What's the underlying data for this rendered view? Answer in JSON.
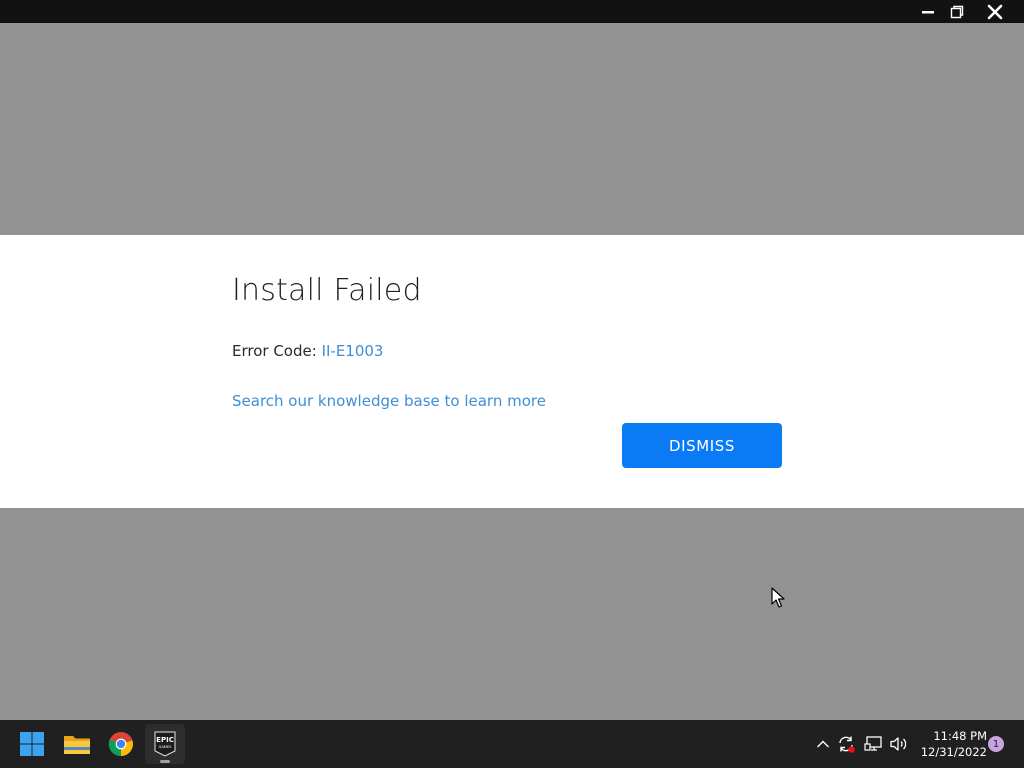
{
  "window": {
    "controls": {
      "minimize_icon": "minimize-icon",
      "restore_icon": "restore-icon",
      "close_icon": "close-icon"
    }
  },
  "dialog": {
    "title": "Install Failed",
    "error_label": "Error Code: ",
    "error_code": "II-E1003",
    "kb_link": "Search our knowledge base to learn more",
    "dismiss_label": "DISMISS"
  },
  "taskbar": {
    "apps": [
      {
        "name": "Start",
        "icon": "windows-start-icon"
      },
      {
        "name": "File Explorer",
        "icon": "folder-icon"
      },
      {
        "name": "Google Chrome",
        "icon": "chrome-icon"
      },
      {
        "name": "Epic Games Launcher",
        "icon": "epic-games-icon",
        "logo_text": "EPIC GAMES"
      }
    ],
    "tray": {
      "clock_time": "11:48 PM",
      "clock_date": "12/31/2022",
      "notification_count": "1"
    }
  },
  "colors": {
    "accent": "#0a7af5",
    "link": "#3f8fd6",
    "overlay": "#929292",
    "taskbar": "#202020",
    "titlebar": "#121212"
  }
}
